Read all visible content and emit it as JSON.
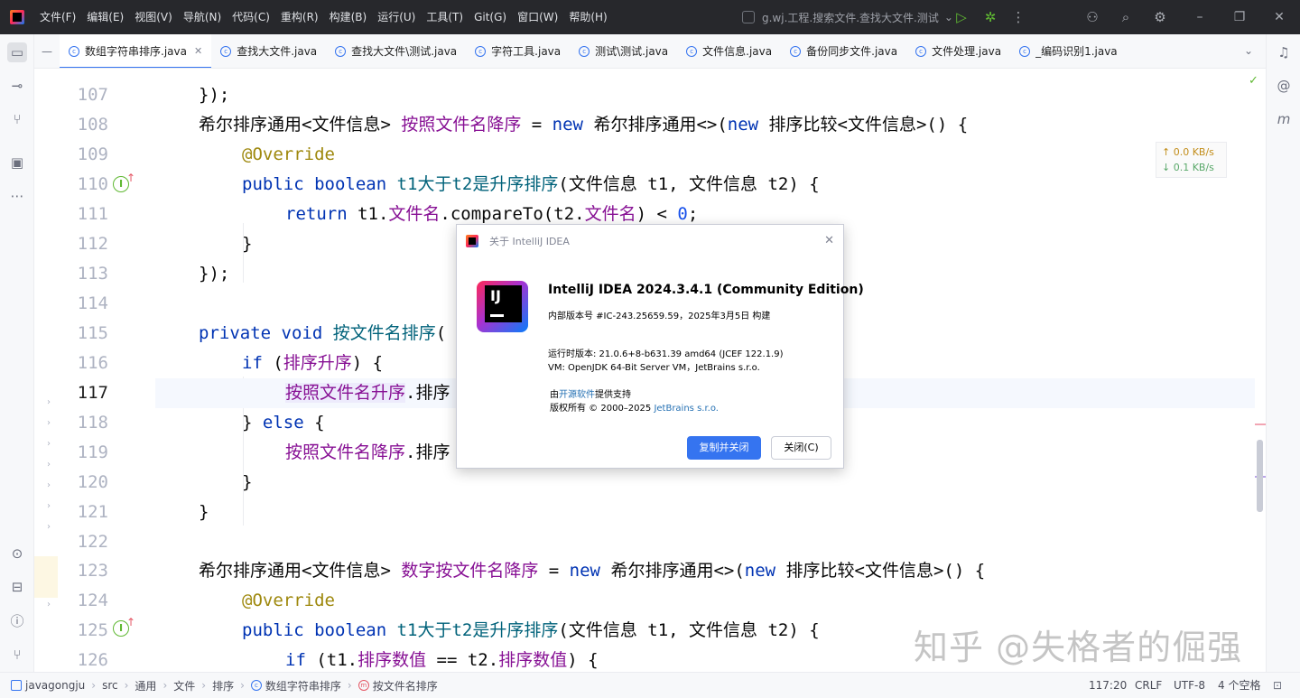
{
  "menu": [
    "文件(F)",
    "编辑(E)",
    "视图(V)",
    "导航(N)",
    "代码(C)",
    "重构(R)",
    "构建(B)",
    "运行(U)",
    "工具(T)",
    "Git(G)",
    "窗口(W)",
    "帮助(H)"
  ],
  "project_widget": "g.wj.工程.搜索文件.查找大文件.测试",
  "tabs": [
    {
      "label": "数组字符串排序.java",
      "active": true
    },
    {
      "label": "查找大文件.java"
    },
    {
      "label": "查找大文件\\测试.java"
    },
    {
      "label": "字符工具.java"
    },
    {
      "label": "测试\\测试.java"
    },
    {
      "label": "文件信息.java"
    },
    {
      "label": "备份同步文件.java"
    },
    {
      "label": "文件处理.java"
    },
    {
      "label": "_编码识别1.java"
    }
  ],
  "editor": {
    "line_numbers": [
      "107",
      "108",
      "109",
      "110",
      "111",
      "112",
      "113",
      "114",
      "115",
      "116",
      "117",
      "118",
      "119",
      "120",
      "121",
      "122",
      "123",
      "124",
      "125",
      "126"
    ],
    "current_line": "117"
  },
  "net_widget": {
    "up": "↑ 0.0 KB/s",
    "down": "↓ 0.1 KB/s"
  },
  "dialog": {
    "title": "关于 IntelliJ IDEA",
    "logo_text": "IJ",
    "product": "IntelliJ IDEA 2024.3.4.1 (Community Edition)",
    "build": "内部版本号 #IC-243.25659.59，2025年3月5日 构建",
    "runtime": "运行时版本: 21.0.6+8-b631.39 amd64 (JCEF 122.1.9)",
    "vm": "VM: OpenJDK 64-Bit Server VM，JetBrains s.r.o.",
    "powered_prefix": "由",
    "powered_link": "开源软件",
    "powered_suffix": "提供支持",
    "copyright_prefix": "版权所有 © 2000–2025 ",
    "copyright_link": "JetBrains s.r.o.",
    "copy_button": "复制并关闭",
    "close_button": "关闭(C)"
  },
  "breadcrumbs": [
    "javagongju",
    "src",
    "通用",
    "文件",
    "排序",
    "数组字符串排序",
    "按文件名排序"
  ],
  "status": {
    "position": "117:20",
    "line_sep": "CRLF",
    "encoding": "UTF-8",
    "indent": "4 个空格"
  },
  "watermark": "知乎 @失格者的倔强",
  "colors": {
    "accent": "#3574f0",
    "keyword": "#0033b3",
    "field": "#871094",
    "annotation": "#9e880d"
  }
}
